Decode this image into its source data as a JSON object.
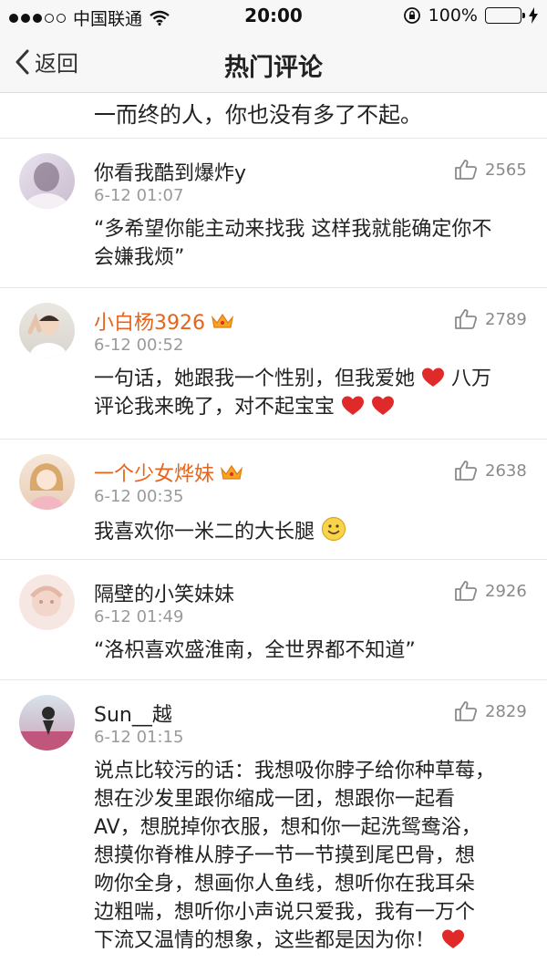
{
  "status_bar": {
    "carrier": "中国联通",
    "time": "20:00",
    "battery": "100%"
  },
  "nav": {
    "back_label": "返回",
    "title": "热门评论"
  },
  "partial_comment_text": "一而终的人，你也没有多了不起。",
  "comments": [
    {
      "username": "你看我酷到爆炸y",
      "time": "6-12 01:07",
      "likes": "2565",
      "text_line1": "“多希望你能主动来找我 这样我就能确定你不",
      "text_line2": "会嫌我烦”"
    },
    {
      "username": "小白杨3926",
      "time": "6-12 00:52",
      "likes": "2789",
      "text_line1": "一句话，她跟我一个性别，但我爱她",
      "text_line1_tail": "八万",
      "text_line2": "评论我来晚了，对不起宝宝"
    },
    {
      "username": "一个少女烨妹",
      "time": "6-12 00:35",
      "likes": "2638",
      "text_line1": "我喜欢你一米二的大长腿"
    },
    {
      "username": "隔壁的小笑妹妹",
      "time": "6-12 01:49",
      "likes": "2926",
      "text_line1": "“洛枳喜欢盛淮南，全世界都不知道”"
    },
    {
      "username": "Sun__越",
      "time": "6-12 01:15",
      "likes": "2829",
      "lines": [
        "说点比较污的话：我想吸你脖子给你种草莓，",
        "想在沙发里跟你缩成一团，想跟你一起看",
        "AV，想脱掉你衣服，想和你一起洗鸳鸯浴，",
        "想摸你脊椎从脖子一节一节摸到尾巴骨，想",
        "吻你全身，想画你人鱼线，想听你在我耳朵",
        "边粗喘，想听你小声说只爱我，我有一万个",
        "下流又温情的想象，这些都是因为你！"
      ]
    }
  ],
  "colors": {
    "vip_name": "#e8631a",
    "heart": "#e02a2a",
    "time_gray": "#9a9a9a"
  },
  "icons": [
    "signal-dots-icon",
    "wifi-icon",
    "rotation-lock-icon",
    "battery-icon",
    "charging-icon",
    "back-chevron-icon",
    "thumbs-up-icon",
    "crown-icon",
    "heart-icon",
    "smile-icon"
  ]
}
